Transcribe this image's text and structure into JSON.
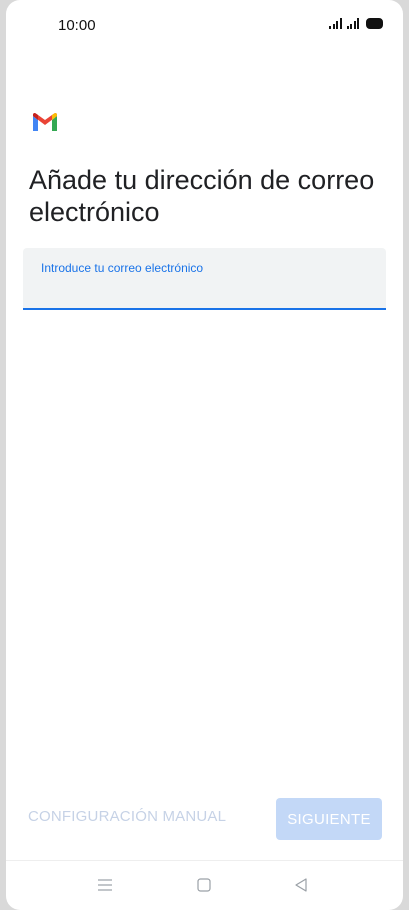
{
  "status_bar": {
    "time": "10:00"
  },
  "app": {
    "logo_icon": "gmail-logo-icon",
    "colors": {
      "gmail_red": "#EA4335",
      "gmail_blue": "#4285F4",
      "gmail_green": "#34A853",
      "gmail_yellow": "#FBBC04",
      "accent": "#1A73E8"
    }
  },
  "page": {
    "title": "Añade tu dirección de correo electrónico"
  },
  "email_field": {
    "label": "Introduce tu correo electrónico",
    "value": ""
  },
  "actions": {
    "manual_config_label": "CONFIGURACIÓN MANUAL",
    "next_label": "SIGUIENTE"
  },
  "nav_bar": {
    "icons": [
      "menu-icon",
      "home-icon",
      "back-icon"
    ]
  }
}
